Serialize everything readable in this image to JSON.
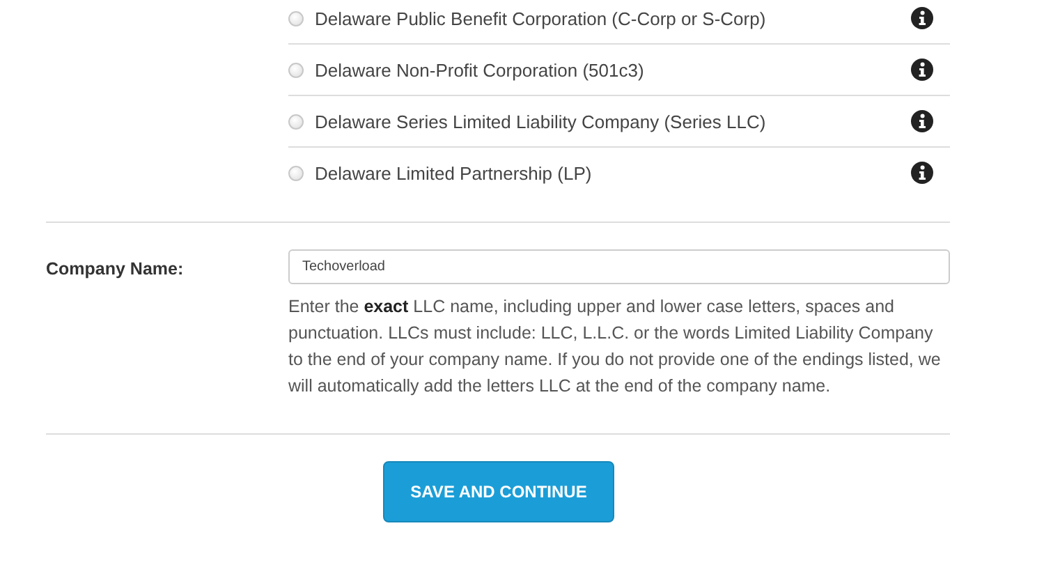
{
  "options": [
    {
      "label": "Delaware Public Benefit Corporation (C-Corp or S-Corp)",
      "selected": false
    },
    {
      "label": "Delaware Non-Profit Corporation (501c3)",
      "selected": false
    },
    {
      "label": "Delaware Series Limited Liability Company (Series LLC)",
      "selected": false
    },
    {
      "label": "Delaware Limited Partnership (LP)",
      "selected": false
    }
  ],
  "company_name": {
    "label": "Company Name:",
    "value": "Techoverload",
    "help": "Enter the **exact** LLC name, including upper and lower case letters, spaces and punctuation. LLCs must include: LLC, L.L.C. or the words Limited Liability Company to the end of your company name. If you do not provide one of the endings listed, we will automatically add the letters LLC at the end of the company name."
  },
  "button": "SAVE AND CONTINUE"
}
